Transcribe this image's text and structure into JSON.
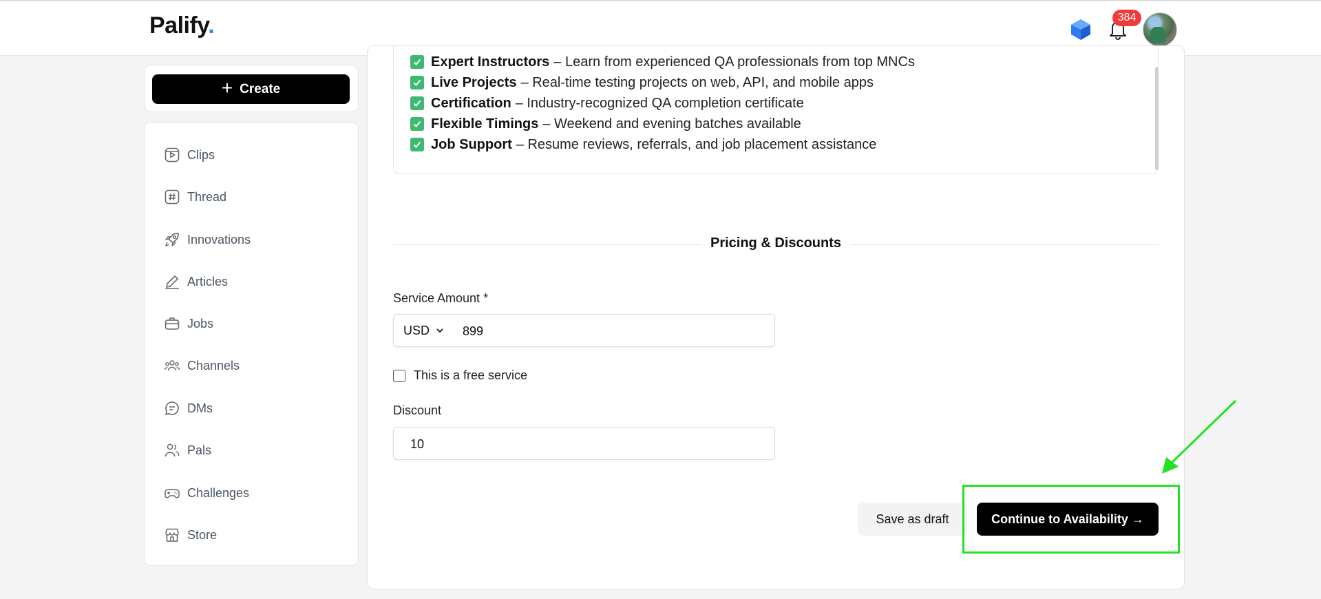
{
  "header": {
    "logo_text": "Palify",
    "logo_dot": ".",
    "notification_count": "384",
    "icons": [
      "diamond-gem-icon",
      "bell-icon",
      "user-avatar"
    ]
  },
  "sidebar": {
    "create_label": "Create",
    "items": [
      {
        "label": "Clips",
        "icon": "clips-play-icon"
      },
      {
        "label": "Thread",
        "icon": "hash-icon"
      },
      {
        "label": "Innovations",
        "icon": "rocket-icon"
      },
      {
        "label": "Articles",
        "icon": "pencil-icon"
      },
      {
        "label": "Jobs",
        "icon": "briefcase-icon"
      },
      {
        "label": "Channels",
        "icon": "people-group-icon"
      },
      {
        "label": "DMs",
        "icon": "chat-bubble-icon"
      },
      {
        "label": "Pals",
        "icon": "users-icon"
      },
      {
        "label": "Challenges",
        "icon": "gamepad-icon"
      },
      {
        "label": "Store",
        "icon": "store-icon"
      }
    ]
  },
  "features": [
    {
      "title": "Expert Instructors",
      "text": "– Learn from experienced QA professionals from top MNCs"
    },
    {
      "title": "Live Projects",
      "text": "– Real-time testing projects on web, API, and mobile apps"
    },
    {
      "title": "Certification",
      "text": "– Industry-recognized QA completion certificate"
    },
    {
      "title": "Flexible Timings",
      "text": "– Weekend and evening batches available"
    },
    {
      "title": "Job Support",
      "text": "– Resume reviews, referrals, and job placement assistance"
    }
  ],
  "pricing": {
    "section_title": "Pricing & Discounts",
    "amount_label": "Service Amount *",
    "currency": "USD",
    "amount_value": "899",
    "free_service_label": "This is a free service",
    "free_service_checked": false,
    "discount_label": "Discount",
    "discount_value": "10"
  },
  "actions": {
    "save_draft": "Save as draft",
    "continue": "Continue to Availability →"
  },
  "annotation": {
    "color": "#22e222"
  },
  "colors": {
    "accent_black": "#000000",
    "check_green": "#3fb871",
    "badge_red": "#ef3b3b",
    "logo_dot": "#2d7ff9"
  }
}
